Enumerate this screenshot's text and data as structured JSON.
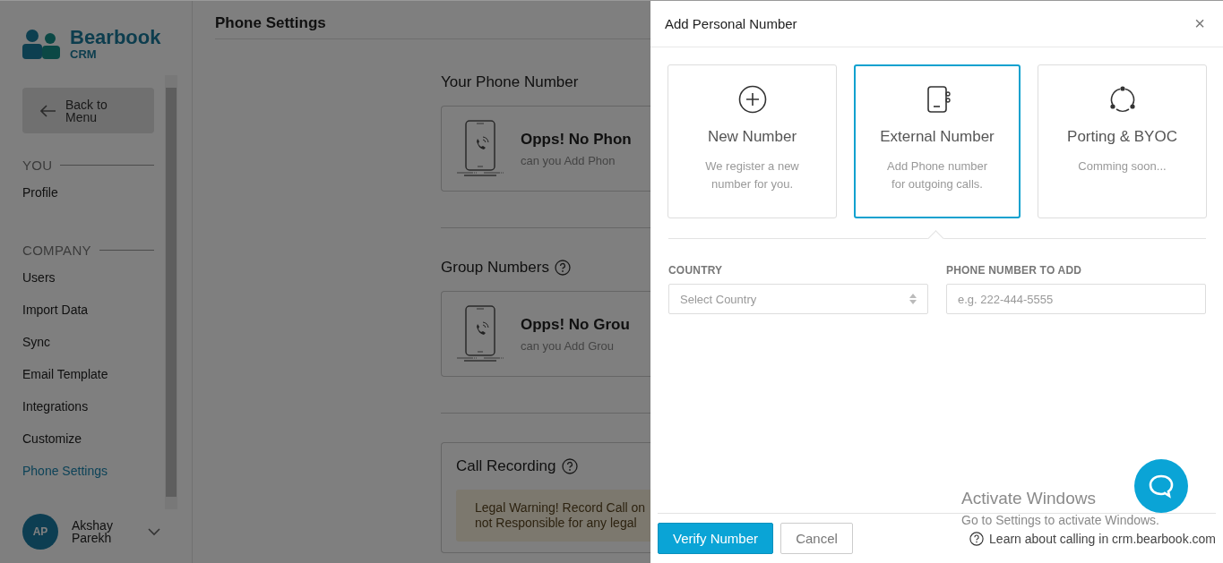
{
  "sidebar": {
    "logo": {
      "name": "Bearbook",
      "sub": "CRM"
    },
    "back_button": "Back to\nMenu",
    "sections": [
      {
        "heading": "YOU",
        "items": [
          {
            "label": "Profile",
            "selected": false
          }
        ]
      },
      {
        "heading": "COMPANY",
        "items": [
          {
            "label": "Users",
            "selected": false
          },
          {
            "label": "Import Data",
            "selected": false
          },
          {
            "label": "Sync",
            "selected": false
          },
          {
            "label": "Email Template",
            "selected": false
          },
          {
            "label": "Integrations",
            "selected": false
          },
          {
            "label": "Customize",
            "selected": false
          },
          {
            "label": "Phone Settings",
            "selected": true
          }
        ]
      }
    ],
    "user": {
      "initials": "AP",
      "name": "Akshay\nParekh"
    }
  },
  "main": {
    "title": "Phone Settings",
    "sections": [
      {
        "kind": "empty",
        "heading": "Your Phone Number",
        "help": false,
        "title": "Opps! No Phon",
        "subtitle": "can you Add Phon"
      },
      {
        "kind": "empty",
        "heading": "Group Numbers",
        "help": true,
        "title": "Opps! No Grou",
        "subtitle": "can you Add Grou"
      },
      {
        "kind": "warning",
        "heading": "Call Recording",
        "help": true,
        "text": "Legal Warning! Record Call on\nnot Responsible for any legal"
      }
    ]
  },
  "drawer": {
    "title": "Add Personal Number",
    "close": "×",
    "options": [
      {
        "kind": "plus",
        "title": "New Number",
        "description": "We register a new\nnumber for you.",
        "selected": false
      },
      {
        "kind": "phonebook",
        "title": "External Number",
        "description": "Add Phone number\nfor outgoing calls.",
        "selected": true
      },
      {
        "kind": "cycle",
        "title": "Porting & BYOC",
        "description": "Comming soon...",
        "selected": false
      }
    ],
    "fields": [
      {
        "kind": "select",
        "label": "COUNTRY",
        "placeholder": "Select Country"
      },
      {
        "kind": "text",
        "label": "PHONE NUMBER TO ADD",
        "placeholder": "e.g. 222-444-5555"
      }
    ],
    "buttons": [
      {
        "label": "Verify Number",
        "kind": "primary"
      },
      {
        "label": "Cancel",
        "kind": "secondary"
      }
    ],
    "help_link": "Learn about calling in crm.bearbook.com"
  },
  "os_overlay": {
    "title": "Activate Windows",
    "text": "Go to Settings to activate Windows."
  }
}
